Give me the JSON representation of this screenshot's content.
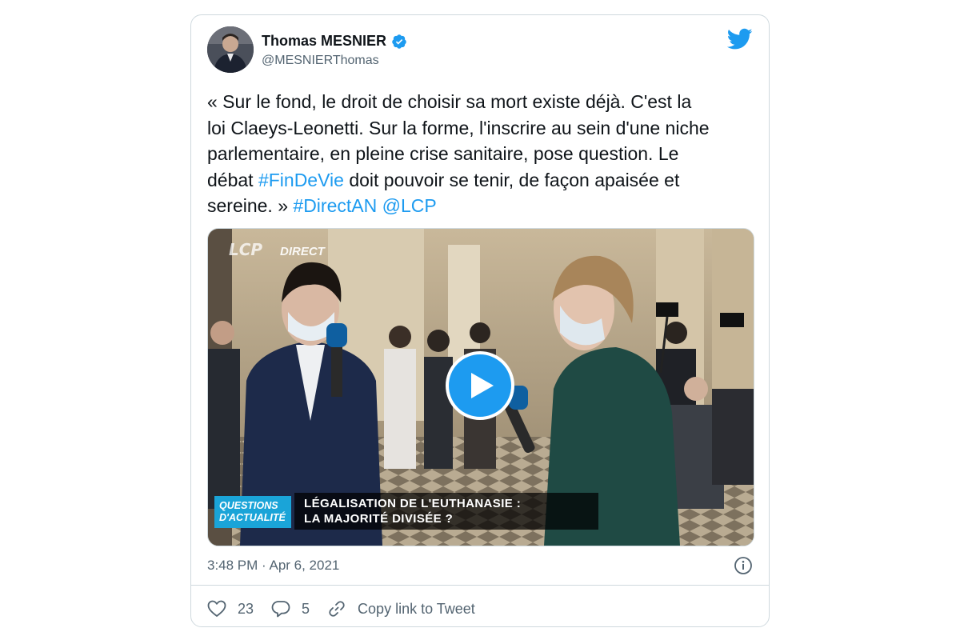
{
  "author": {
    "name": "Thomas MESNIER",
    "handle": "@MESNIERThomas",
    "verified": true
  },
  "tweet": {
    "text_lines": [
      "« Sur le fond, le droit de choisir sa mort existe déjà. C'est la",
      "loi Claeys-Leonetti. Sur la forme, l'inscrire au sein d'une niche",
      "parlementaire, en pleine crise sanitaire, pose question. Le",
      "débat ",
      "#FinDeVie",
      " doit pouvoir se tenir, de façon apaisée et",
      "sereine. » ",
      "#DirectAN",
      " ",
      "@LCP"
    ],
    "timestamp": "3:48 PM · Apr 6, 2021"
  },
  "media": {
    "channel_logo": "LCP",
    "live_tag": "DIRECT",
    "banner_label_line1": "QUESTIONS",
    "banner_label_line2": "D'ACTUALITÉ",
    "headline_line1": "LÉGALISATION DE L'EUTHANASIE :",
    "headline_line2": "LA MAJORITÉ DIVISÉE ?"
  },
  "actions": {
    "likes": "23",
    "replies": "5",
    "copy_link": "Copy link to Tweet"
  },
  "icons": {
    "brand": "twitter-bird-icon",
    "verified": "verified-badge-icon",
    "info": "info-icon",
    "like": "heart-icon",
    "reply": "reply-bubble-icon",
    "link": "link-icon",
    "play": "play-icon"
  },
  "colors": {
    "accent": "#1d9bf0",
    "text": "#0f1419",
    "muted": "#536471",
    "border": "#cfd9de"
  }
}
